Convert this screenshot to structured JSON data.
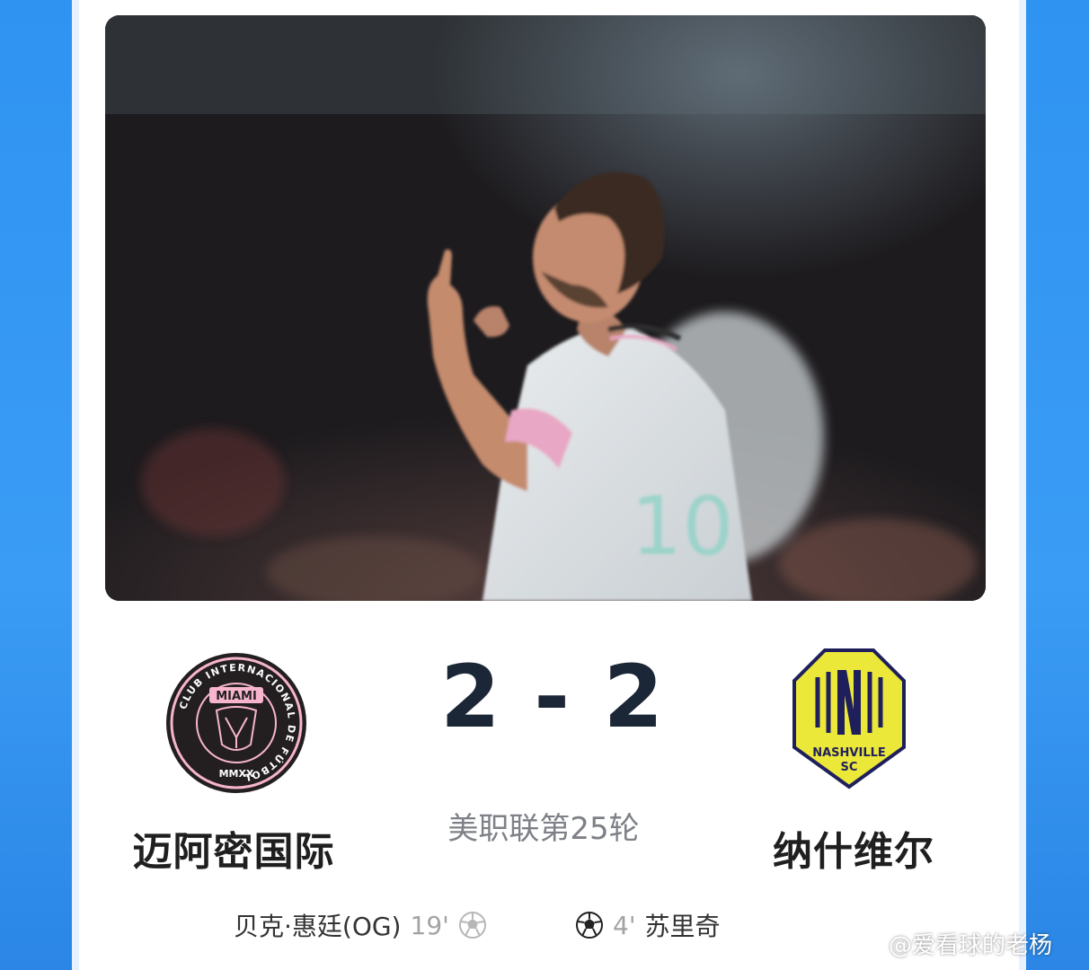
{
  "match": {
    "home_team": "迈阿密国际",
    "away_team": "纳什维尔",
    "score": "2 - 2",
    "competition_round": "美职联第25轮"
  },
  "home_logo": {
    "ring_text": "CLUB INTERNACIONAL DE FÚTBOL",
    "name": "MIAMI",
    "year": "MMXX",
    "colors": {
      "ring": "#f7b5cd",
      "body": "#231f20"
    }
  },
  "away_logo": {
    "line1": "NASHVILLE",
    "line2": "SC",
    "colors": {
      "fill": "#ece83a",
      "ink": "#1f1f5c"
    }
  },
  "scorers": {
    "home": {
      "player": "贝克·惠廷(OG)",
      "minute": "19'",
      "icon": "soccer-ball-icon"
    },
    "away": {
      "player": "苏里奇",
      "minute": "4'",
      "icon": "soccer-ball-icon"
    }
  },
  "watermark": {
    "text": "@爱看球的老杨",
    "icon": "weibo-icon"
  },
  "colors": {
    "frame_blue": "#2f93f2",
    "score_text": "#1b2636",
    "muted_text": "#7d8086"
  }
}
